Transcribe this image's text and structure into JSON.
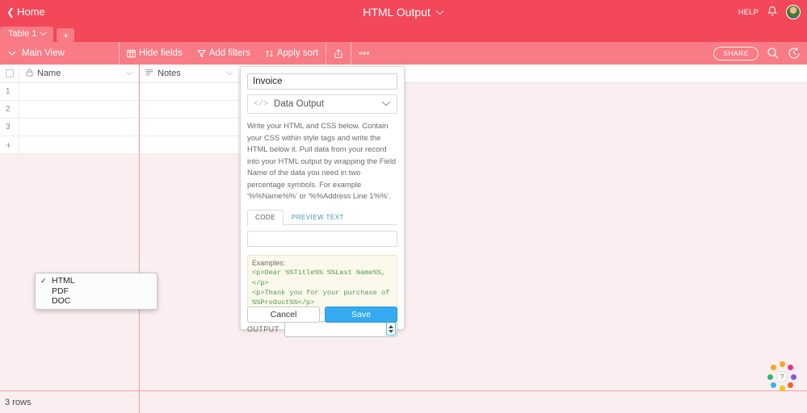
{
  "colors": {
    "topbar": "#f2485a",
    "viewbar": "#f97b85",
    "background": "#fbeef0",
    "save_button": "#35aaf0",
    "focus_accent": "#4fc3cf",
    "code_text": "#4e9b4e"
  },
  "topbar": {
    "home_label": "Home",
    "back_icon": "chevron-left-icon",
    "app_title": "HTML Output",
    "title_caret_icon": "chevron-down-icon",
    "help_label": "HELP",
    "bell_icon": "notification-bell-icon",
    "avatar_icon": "user-avatar"
  },
  "tabstrip": {
    "tabs": [
      {
        "label": "Table 1",
        "caret_icon": "chevron-down-icon"
      }
    ],
    "add_label": "+"
  },
  "viewbar": {
    "view_caret_icon": "chevron-down-icon",
    "view_name": "Main View",
    "tools": [
      {
        "label": "Hide fields",
        "icon": "columns-icon"
      },
      {
        "label": "Add filters",
        "icon": "filter-funnel-icon"
      },
      {
        "label": "Apply sort",
        "icon": "sort-arrows-icon"
      }
    ],
    "share_icon": "share-upload-icon",
    "more_icon": "ellipsis-icon",
    "share_label": "SHARE",
    "search_icon": "search-icon",
    "history_icon": "revision-history-icon"
  },
  "grid": {
    "columns": [
      {
        "label": "Name",
        "icon": "lock-icon",
        "caret_icon": "chevron-down-icon"
      },
      {
        "label": "Notes",
        "icon": "long-text-icon",
        "caret_icon": "chevron-down-icon"
      }
    ],
    "rows": [
      {
        "num": "1",
        "name": "",
        "notes": ""
      },
      {
        "num": "2",
        "name": "",
        "notes": ""
      },
      {
        "num": "3",
        "name": "",
        "notes": ""
      }
    ],
    "add_row_label": "+"
  },
  "statusbar": {
    "row_count": "3 rows"
  },
  "panel": {
    "field_name_value": "Invoice",
    "field_name_placeholder": "Field name",
    "field_type_label": "Data Output",
    "field_type_icon": "code-brackets-icon",
    "field_type_caret_icon": "chevron-down-icon",
    "description": "Write your HTML and CSS below. Contain your CSS within style tags and write the HTML below it. Pull data from your record into your HTML output by wrapping the Field Name of the data you need in two percentage symbols. For example '%%Name%%' or '%%Address Line 1%%'.",
    "tabs": [
      {
        "label": "CODE",
        "active": true
      },
      {
        "label": "PREVIEW TEXT",
        "active": false
      }
    ],
    "code_value": "",
    "code_placeholder": "",
    "examples_label": "Examples:",
    "examples_code": "<p>Dear %%Title%% %%Last Name%%,</p>\n<p>Thank you for your purchase of %%Product%%</p>",
    "output_label": "OUTPUT",
    "output_selected": "HTML",
    "output_options": [
      {
        "label": "HTML",
        "checked": true
      },
      {
        "label": "PDF",
        "checked": false
      },
      {
        "label": "DOC",
        "checked": false
      }
    ],
    "cancel_label": "Cancel",
    "save_label": "Save"
  },
  "help_widget": {
    "glyph": "?",
    "icon": "help-question-icon"
  }
}
